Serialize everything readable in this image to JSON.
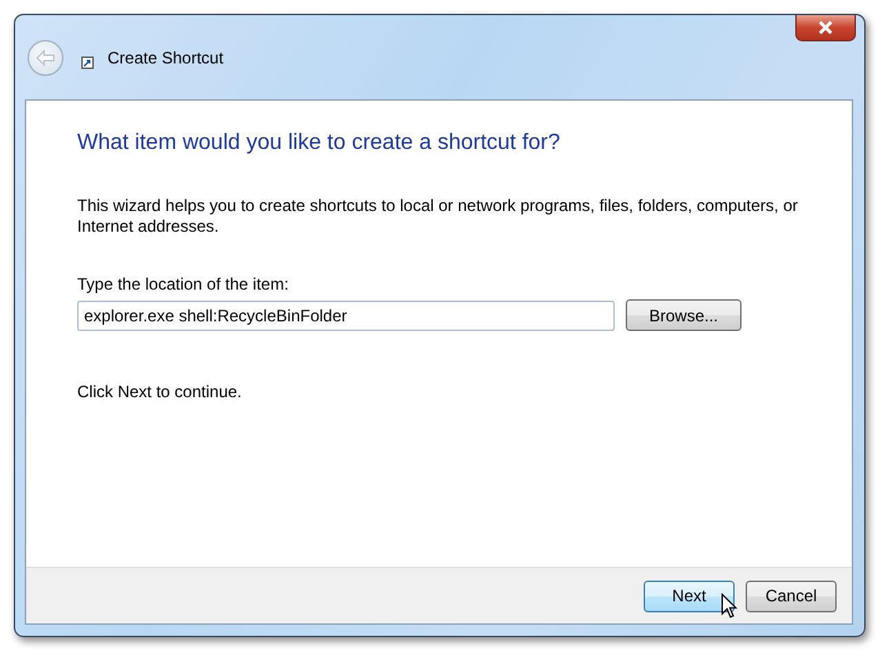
{
  "window": {
    "title": "Create Shortcut"
  },
  "heading": "What item would you like to create a shortcut for?",
  "description": "This wizard helps you to create shortcuts to local or network programs, files, folders, computers, or Internet addresses.",
  "location": {
    "label": "Type the location of the item:",
    "value": "explorer.exe shell:RecycleBinFolder",
    "browse_button": "Browse..."
  },
  "hint": "Click Next to continue.",
  "buttons": [
    {
      "label": "Next",
      "highlighted": true
    },
    {
      "label": "Cancel",
      "highlighted": false
    }
  ]
}
